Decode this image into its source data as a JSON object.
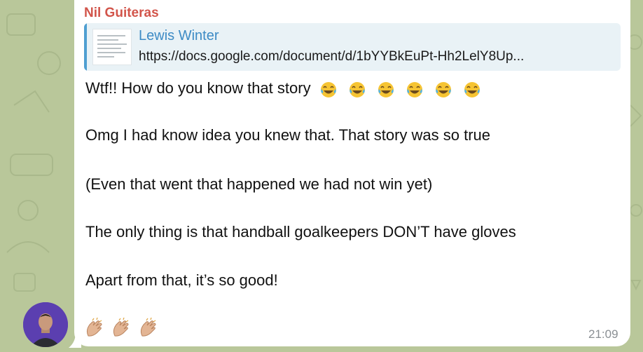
{
  "message": {
    "sender": "Nil Guiteras",
    "quote": {
      "author": "Lewis Winter",
      "text": "https://docs.google.com/document/d/1bYYBkEuPt-Hh2LelY8Up..."
    },
    "lines": [
      "Wtf!! How do you know that story",
      "Omg I had know idea you knew that. That story was so true",
      "(Even that went that happened we had not win yet)",
      "The only thing is that handball goalkeepers DON’T have gloves",
      "Apart from that, it’s so good!"
    ],
    "line1_emojis": [
      "joy-tears-icon",
      "joy-tears-icon",
      "joy-tears-icon",
      "joy-tears-icon",
      "joy-tears-icon",
      "joy-tears-icon"
    ],
    "reactions": [
      "clapping-hands-icon",
      "clapping-hands-icon",
      "clapping-hands-icon"
    ],
    "time": "21:09"
  },
  "colors": {
    "background": "#b9c79a",
    "sender": "#d2554b",
    "quote_accent": "#4f9fd1",
    "quote_bg": "#e9f2f6",
    "avatar_bg": "#5b3fb0"
  }
}
